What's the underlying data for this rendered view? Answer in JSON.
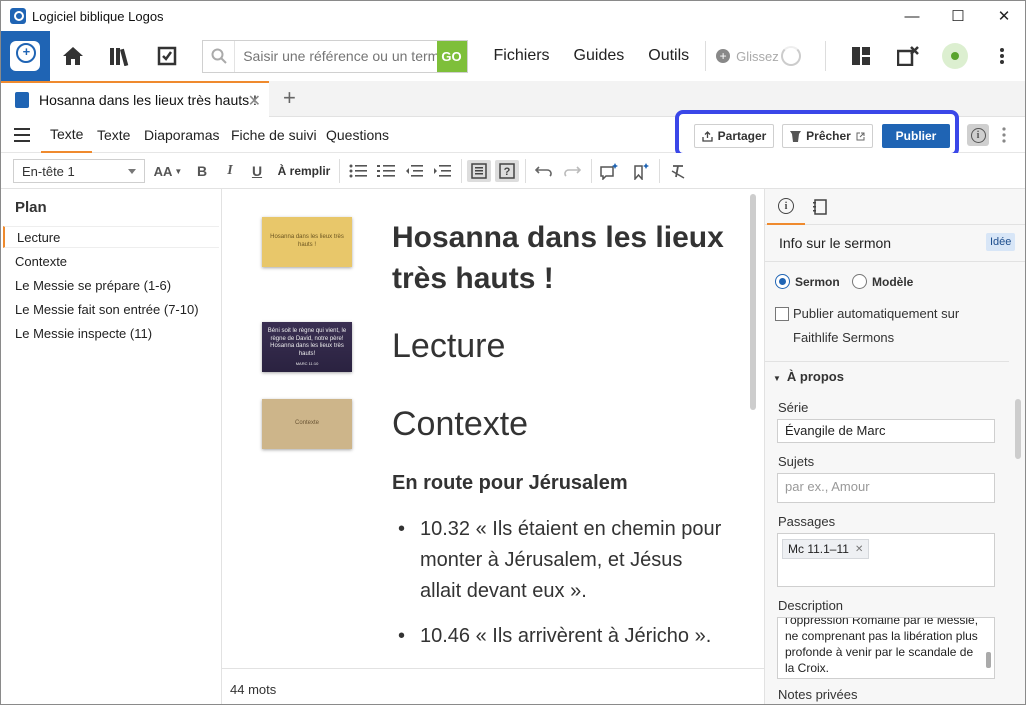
{
  "window": {
    "title": "Logiciel biblique Logos",
    "minimize": "—",
    "maximize": "☐",
    "close": "✕"
  },
  "toolbar": {
    "search_placeholder": "Saisir une référence ou un terme",
    "go_label": "GO",
    "menus": [
      "Fichiers",
      "Guides",
      "Outils"
    ],
    "drag_label": "Glissez"
  },
  "tab": {
    "title": "Hosanna dans les lieux très hauts !",
    "close": "✕",
    "add": "+"
  },
  "subtabs": [
    "Texte",
    "Texte",
    "Diaporamas",
    "Fiche de suivi",
    "Questions"
  ],
  "actions": {
    "share": "Partager",
    "preach": "Prêcher",
    "publish": "Publier"
  },
  "format": {
    "style": "En-tête 1",
    "fill": "À remplir",
    "bold": "B",
    "italic": "I",
    "underline": "U",
    "font": "AA"
  },
  "outline": {
    "title": "Plan",
    "items": [
      "Lecture",
      "Contexte",
      "Le Messie se prépare (1-6)",
      "Le Messie fait son entrée (7-10)",
      "Le Messie inspecte (11)"
    ]
  },
  "document": {
    "title": "Hosanna dans les lieux très hauts !",
    "heading_lecture": "Lecture",
    "heading_contexte": "Contexte",
    "subheading": "En route pour Jérusalem",
    "bullets": [
      "10.32 « Ils étaient en chemin pour monter à Jérusalem, et Jésus allait devant eux ».",
      "10.46 « Ils arrivèrent à Jéricho »."
    ],
    "word_count": "44 mots",
    "slide1_text": "Hosanna dans les lieux très hauts !",
    "slide2_text": "Béni soit le règne qui vient, le règne de David, notre père! Hosanna dans les lieux très hauts!",
    "slide2_ref": "MARC 11:10",
    "slide3_text": "Contexte"
  },
  "sermon_info": {
    "title": "Info sur le sermon",
    "badge": "Idée",
    "radio_sermon": "Sermon",
    "radio_modele": "Modèle",
    "auto_publish_line1": "Publier automatiquement sur",
    "auto_publish_line2": "Faithlife Sermons",
    "about": "À propos",
    "serie_label": "Série",
    "serie_value": "Évangile de Marc",
    "sujets_label": "Sujets",
    "sujets_placeholder": "par ex., Amour",
    "passages_label": "Passages",
    "passage_chip": "Mc 11.1–11",
    "description_label": "Description",
    "description_text": "l'oppression Romaine par le Messie, ne comprenant pas la libération plus profonde à venir par le scandale de la Croix.",
    "notes_label": "Notes privées"
  },
  "colors": {
    "accent": "#1f64b4",
    "tab_accent": "#ef8a2e",
    "highlight_box": "#3a47e8",
    "go": "#7ebf3a"
  }
}
